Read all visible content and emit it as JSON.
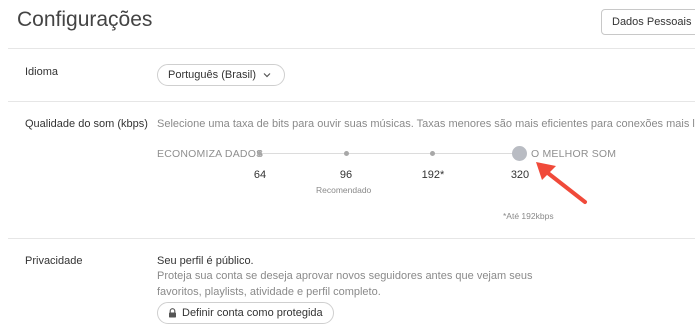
{
  "header": {
    "title": "Configurações",
    "personal_data_button": "Dados Pessoais"
  },
  "language": {
    "label": "Idioma",
    "selected": "Português (Brasil)"
  },
  "quality": {
    "label": "Qualidade do som (kbps)",
    "description": "Selecione uma taxa de bits para ouvir suas músicas. Taxas menores são mais eficientes para conexões mais lentas.",
    "min_label": "ECONOMIZA DADOS",
    "max_label": "O MELHOR SOM",
    "options": [
      "64",
      "96",
      "192*",
      "320"
    ],
    "recommended_label": "Recomendado",
    "footnote": "*Até 192kbps",
    "selected": "320"
  },
  "privacy": {
    "label": "Privacidade",
    "status": "Seu perfil é público.",
    "description": "Proteja sua conta se deseja aprovar novos seguidores antes que vejam seus favoritos, playlists, atividade e perfil completo.",
    "protect_button": "Definir conta como protegida"
  },
  "colors": {
    "annotation_arrow": "#f04a3a",
    "slider_knob": "#b9bcc3"
  }
}
